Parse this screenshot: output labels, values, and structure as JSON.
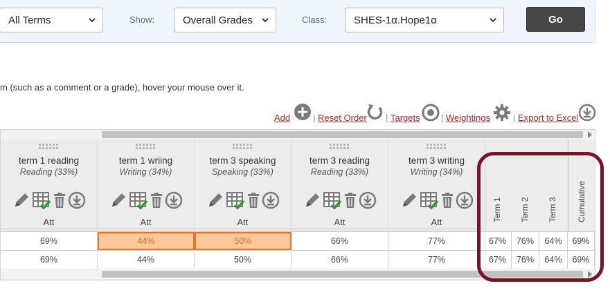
{
  "filters": {
    "terms_value": "All Terms",
    "show_label": "Show:",
    "show_value": "Overall Grades",
    "class_label": "Class:",
    "class_value": "SHES-1α.Hope1α",
    "go_label": "Go"
  },
  "instructions": "m (such as a comment or a grade), hover your mouse over it.",
  "toolbar": {
    "add": "Add",
    "reset_order": "Reset Order",
    "targets": "Targets",
    "weightings": "Weightings",
    "export": "Export to Excel",
    "separator": "|"
  },
  "columns": [
    {
      "title": "term 1 reading",
      "sub": "Reading (33%)",
      "att": "Att"
    },
    {
      "title": "term 1 wriing",
      "sub": "Writing (34%)",
      "att": "Att"
    },
    {
      "title": "term 3 speaking",
      "sub": "Speaking (33%)",
      "att": "Att"
    },
    {
      "title": "term 3 reading",
      "sub": "Reading (33%)",
      "att": "Att"
    },
    {
      "title": "term 3 writing",
      "sub": "Writing (34%)",
      "att": "Att"
    }
  ],
  "summary_headers": [
    "Term 1",
    "Term 2",
    "Term 3",
    "Cumulative"
  ],
  "rows": [
    {
      "cells": [
        "69%",
        "44%",
        "50%",
        "66%",
        "77%"
      ],
      "summary": [
        "67%",
        "76%",
        "64%",
        "69%"
      ]
    },
    {
      "cells": [
        "69%",
        "44%",
        "50%",
        "66%",
        "77%"
      ],
      "summary": [
        "67%",
        "76%",
        "64%",
        "69%"
      ]
    }
  ],
  "colors": {
    "link": "#a52a2a",
    "highlight_fill": "#fbc79b",
    "highlight_border": "#e0782e",
    "callout": "#7a1228"
  }
}
